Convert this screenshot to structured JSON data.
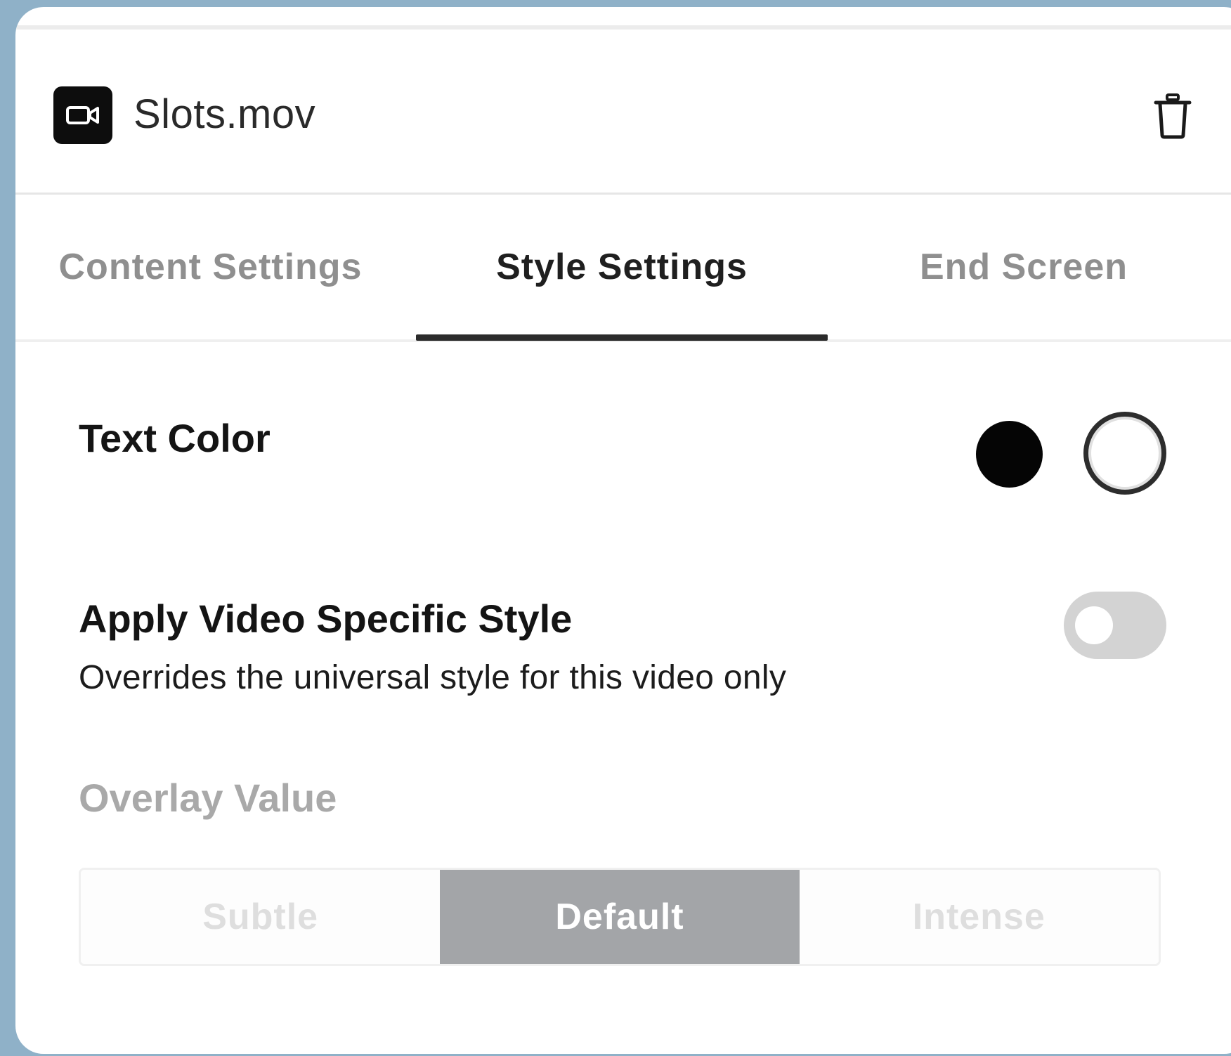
{
  "file": {
    "name": "Slots.mov",
    "icon": "video-camera-icon"
  },
  "actions": {
    "delete_icon": "trash-icon"
  },
  "tabs": [
    {
      "label": "Content Settings",
      "active": false
    },
    {
      "label": "Style Settings",
      "active": true
    },
    {
      "label": "End Screen",
      "active": false
    }
  ],
  "text_color": {
    "label": "Text Color",
    "options": [
      {
        "name": "black",
        "color": "#050505",
        "selected": false
      },
      {
        "name": "white",
        "color": "#ffffff",
        "selected": true
      }
    ]
  },
  "video_style": {
    "label": "Apply Video Specific Style",
    "description": "Overrides the universal style for this video only",
    "enabled": false
  },
  "overlay": {
    "label": "Overlay Value",
    "options": [
      "Subtle",
      "Default",
      "Intense"
    ],
    "selected": "Default",
    "disabled": true
  },
  "colors": {
    "background": "#8fb1c8",
    "active_segment": "#a3a5a8",
    "toggle_off": "#d3d3d3"
  }
}
